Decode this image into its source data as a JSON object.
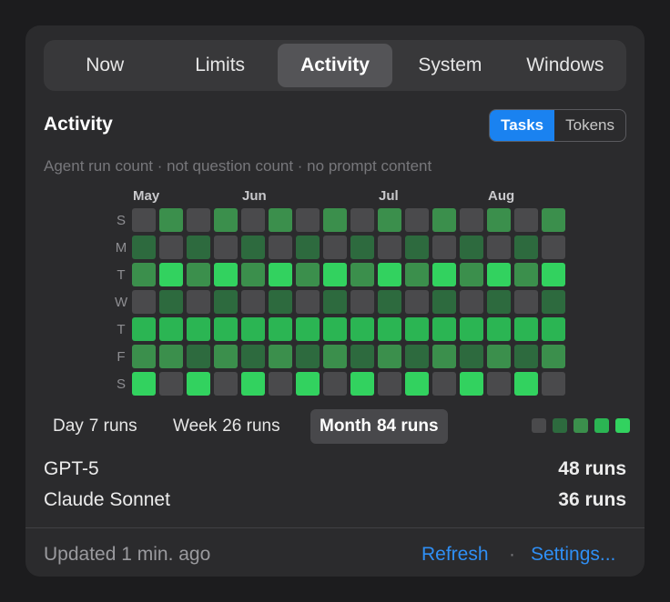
{
  "nav": {
    "tabs": [
      {
        "label": "Now",
        "active": false
      },
      {
        "label": "Limits",
        "active": false
      },
      {
        "label": "Activity",
        "active": true
      },
      {
        "label": "System",
        "active": false
      },
      {
        "label": "Windows",
        "active": false
      }
    ]
  },
  "section": {
    "title": "Activity",
    "toggle": [
      {
        "label": "Tasks",
        "active": true
      },
      {
        "label": "Tokens",
        "active": false
      }
    ],
    "subtitle": "Agent run count · not question count · no prompt content"
  },
  "heatmap": {
    "months": [
      {
        "label": "May",
        "week": 0
      },
      {
        "label": "Jun",
        "week": 4
      },
      {
        "label": "Jul",
        "week": 9
      },
      {
        "label": "Aug",
        "week": 13
      }
    ],
    "days": [
      "S",
      "M",
      "T",
      "W",
      "T",
      "F",
      "S"
    ],
    "level_colors": [
      "#4a4a4c",
      "#2d6a3e",
      "#3b8f4c",
      "#2bb553",
      "#32d25f"
    ],
    "levels": [
      [
        0,
        2,
        0,
        2,
        0,
        2,
        0,
        2,
        0,
        2,
        0,
        2,
        0,
        2,
        0,
        2
      ],
      [
        1,
        0,
        1,
        0,
        1,
        0,
        1,
        0,
        1,
        0,
        1,
        0,
        1,
        0,
        1,
        0
      ],
      [
        2,
        4,
        2,
        4,
        2,
        4,
        2,
        4,
        2,
        4,
        2,
        4,
        2,
        4,
        2,
        4
      ],
      [
        0,
        1,
        0,
        1,
        0,
        1,
        0,
        1,
        0,
        1,
        0,
        1,
        0,
        1,
        0,
        1
      ],
      [
        3,
        3,
        3,
        3,
        3,
        3,
        3,
        3,
        3,
        3,
        3,
        3,
        3,
        3,
        3,
        3
      ],
      [
        2,
        2,
        1,
        2,
        1,
        2,
        1,
        2,
        1,
        2,
        1,
        2,
        1,
        2,
        1,
        2
      ],
      [
        4,
        0,
        4,
        0,
        4,
        0,
        4,
        0,
        4,
        0,
        4,
        0,
        4,
        0,
        4,
        0
      ]
    ]
  },
  "periods": [
    {
      "label": "Day",
      "runs": "7 runs",
      "active": false
    },
    {
      "label": "Week",
      "runs": "26 runs",
      "active": false
    },
    {
      "label": "Month",
      "runs": "84 runs",
      "active": true
    }
  ],
  "models": [
    {
      "name": "GPT-5",
      "runs": "48 runs"
    },
    {
      "name": "Claude Sonnet",
      "runs": "36 runs"
    }
  ],
  "footer": {
    "updated": "Updated 1 min. ago",
    "refresh": "Refresh",
    "separator": "·",
    "settings": "Settings..."
  }
}
